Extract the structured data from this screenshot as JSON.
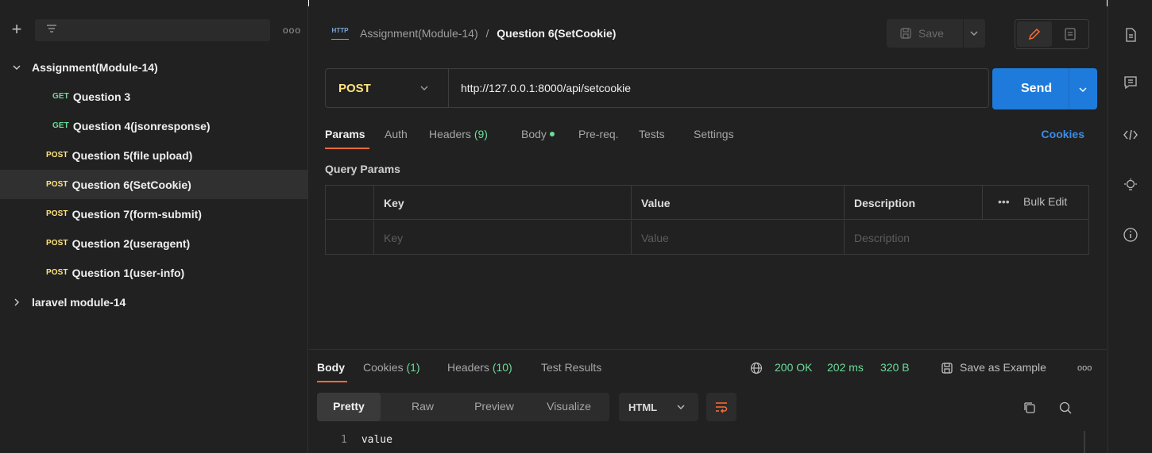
{
  "sidebar": {
    "more_label": "ooo",
    "collections": [
      {
        "name": "Assignment(Module-14)",
        "expanded": true,
        "requests": [
          {
            "method": "GET",
            "name": "Question 3"
          },
          {
            "method": "GET",
            "name": "Question 4(jsonresponse)"
          },
          {
            "method": "POST",
            "name": "Question 5(file upload)"
          },
          {
            "method": "POST",
            "name": "Question 6(SetCookie)",
            "selected": true
          },
          {
            "method": "POST",
            "name": "Question 7(form-submit)"
          },
          {
            "method": "POST",
            "name": "Question 2(useragent)"
          },
          {
            "method": "POST",
            "name": "Question 1(user-info)"
          }
        ]
      },
      {
        "name": "laravel module-14",
        "expanded": false
      }
    ]
  },
  "header": {
    "http_badge": "HTTP",
    "breadcrumb_parent": "Assignment(Module-14)",
    "breadcrumb_sep": "/",
    "breadcrumb_current": "Question 6(SetCookie)",
    "save_label": "Save"
  },
  "request": {
    "method": "POST",
    "url": "http://127.0.0.1:8000/api/setcookie",
    "send_label": "Send",
    "tabs": {
      "params": "Params",
      "auth": "Auth",
      "headers": "Headers",
      "headers_count": "(9)",
      "body": "Body",
      "prereq": "Pre-req.",
      "tests": "Tests",
      "settings": "Settings",
      "cookies": "Cookies"
    },
    "query_params": {
      "title": "Query Params",
      "columns": [
        "Key",
        "Value",
        "Description"
      ],
      "bulk_edit": "Bulk Edit",
      "more": "•••",
      "placeholders": [
        "Key",
        "Value",
        "Description"
      ]
    }
  },
  "response": {
    "tabs": {
      "body": "Body",
      "cookies": "Cookies",
      "cookies_count": "(1)",
      "headers": "Headers",
      "headers_count": "(10)",
      "test_results": "Test Results"
    },
    "status": "200 OK",
    "time": "202 ms",
    "size": "320 B",
    "save_example": "Save as Example",
    "more": "ooo",
    "views": [
      "Pretty",
      "Raw",
      "Preview",
      "Visualize"
    ],
    "format": "HTML",
    "lines": [
      {
        "num": "1",
        "text": "value"
      }
    ]
  },
  "colors": {
    "accent_send": "#1f7bdb",
    "get_method": "#6bdd9a",
    "post_method": "#ffe47e",
    "tab_underline": "#ff6c37",
    "status_ok": "#6bdd9a"
  }
}
